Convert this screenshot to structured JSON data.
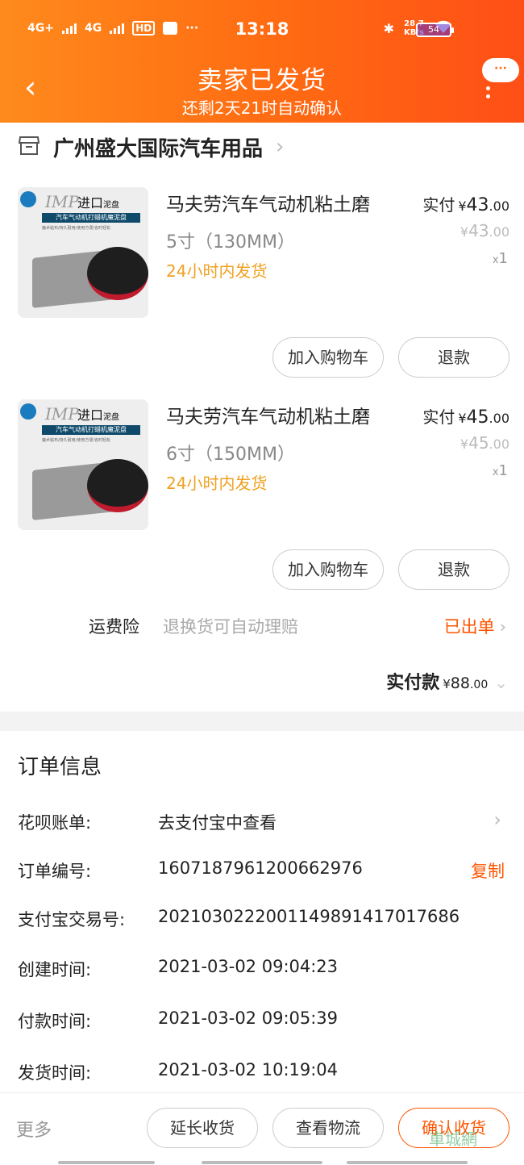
{
  "status_bar": {
    "network1": "4G+",
    "network2": "4G",
    "hd": "HD",
    "time": "13:18",
    "speed": "28.7",
    "speed_unit": "KB/s",
    "battery": "54"
  },
  "header": {
    "title": "卖家已发货",
    "subtitle": "还剩2天21时自动确认",
    "back": "‹",
    "more": "···"
  },
  "shop": {
    "name": "广州盛大国际汽车用品"
  },
  "items": [
    {
      "name": "马夫劳汽车气动机粘土磨",
      "spec": "5寸（130MM）",
      "shipping": "24小时内发货",
      "paid_label": "实付",
      "currency": "¥",
      "paid_int": "43",
      "paid_dec": ".00",
      "orig_int": "43",
      "orig_dec": ".00",
      "qty_x": "x",
      "qty": "1",
      "cart_button": "加入购物车",
      "refund_button": "退款",
      "thumb": {
        "imp": "IMP",
        "import": "进口",
        "sub": "泥盘",
        "band": "汽车气动机打蜡机魔泥盘",
        "fine": "魔术粘布/持久耐用/使用方便/省时轻松"
      }
    },
    {
      "name": "马夫劳汽车气动机粘土磨",
      "spec": "6寸（150MM）",
      "shipping": "24小时内发货",
      "paid_label": "实付",
      "currency": "¥",
      "paid_int": "45",
      "paid_dec": ".00",
      "orig_int": "45",
      "orig_dec": ".00",
      "qty_x": "x",
      "qty": "1",
      "cart_button": "加入购物车",
      "refund_button": "退款",
      "thumb": {
        "imp": "IMP",
        "import": "进口",
        "sub": "泥盘",
        "band": "汽车气动机打蜡机魔泥盘",
        "fine": "魔术粘布/持久耐用/使用方便/省时轻松"
      }
    }
  ],
  "insurance": {
    "label": "运费险",
    "desc": "退换货可自动理赔",
    "status": "已出单"
  },
  "total": {
    "label": "实付款",
    "currency": "¥",
    "int": "88",
    "dec": ".00"
  },
  "order_info": {
    "title": "订单信息",
    "rows": [
      {
        "label": "花呗账单:",
        "value": "去支付宝中查看"
      },
      {
        "label": "订单编号:",
        "value": "1607187961200662976",
        "action": "复制"
      },
      {
        "label": "支付宝交易号:",
        "value": "2021030222001149891417017686"
      },
      {
        "label": "创建时间:",
        "value": "2021-03-02 09:04:23"
      },
      {
        "label": "付款时间:",
        "value": "2021-03-02 09:05:39"
      },
      {
        "label": "发货时间:",
        "value": "2021-03-02 10:19:04"
      }
    ]
  },
  "bottom_bar": {
    "more": "更多",
    "extend": "延长收货",
    "logistics": "查看物流",
    "confirm": "确认收货"
  },
  "watermark": "車城網",
  "colors": {
    "header_start": "#ff8a1c",
    "header_end": "#ff4f17",
    "accent": "#ff5500",
    "shipping": "#f0a020"
  }
}
